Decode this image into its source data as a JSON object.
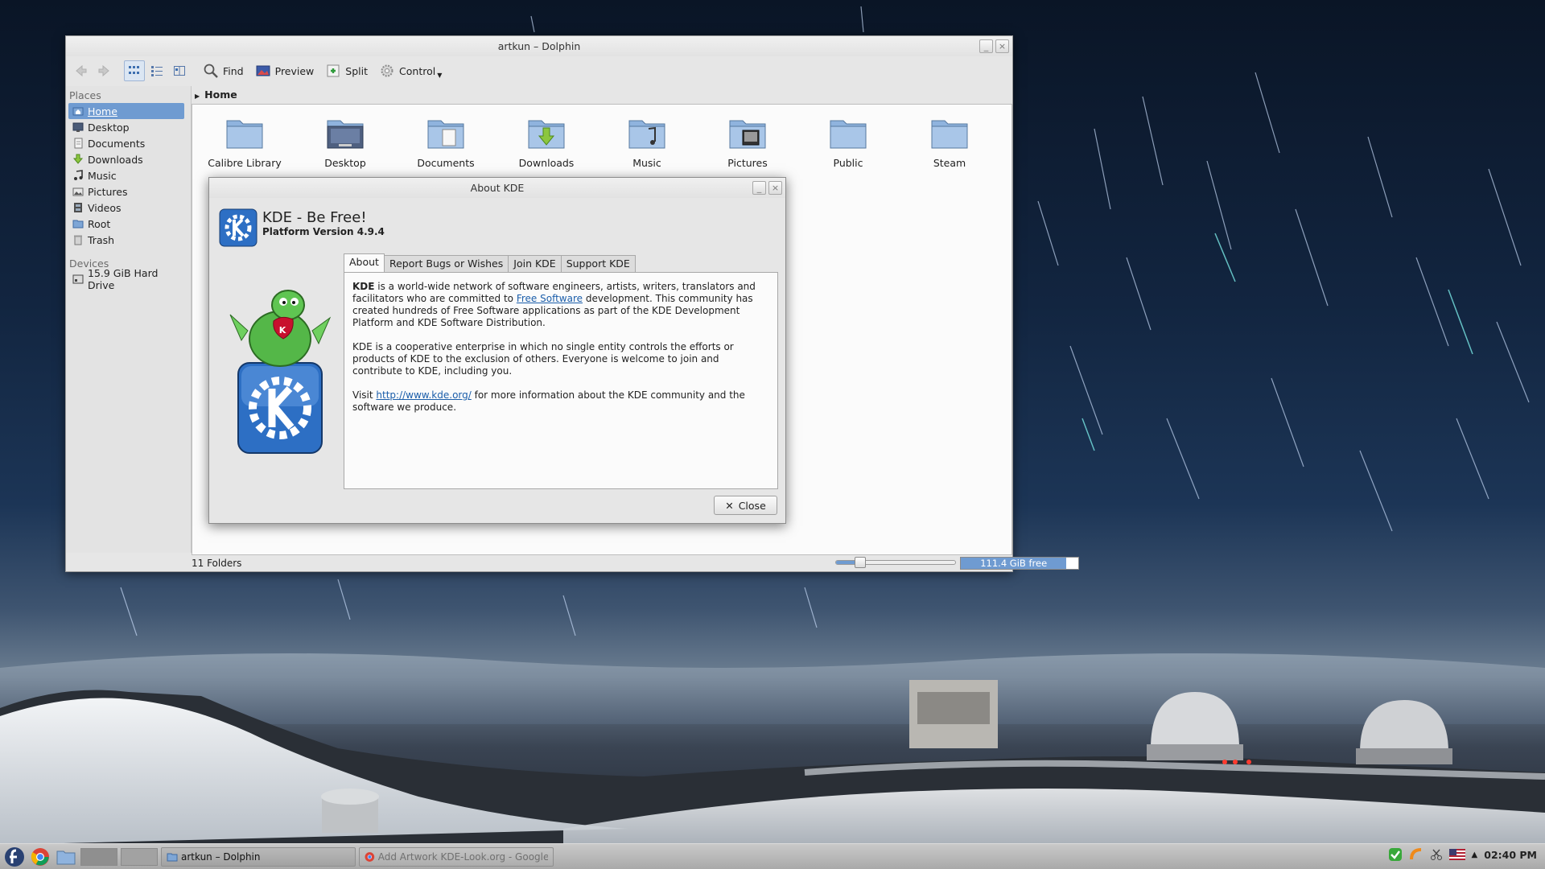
{
  "window": {
    "title": "artkun – Dolphin",
    "minimize_glyph": "_",
    "close_glyph": "×"
  },
  "toolbar": {
    "back_icon": "back-arrow-icon",
    "forward_icon": "forward-arrow-icon",
    "find_label": "Find",
    "preview_label": "Preview",
    "split_label": "Split",
    "control_label": "Control"
  },
  "places": {
    "places_heading": "Places",
    "devices_heading": "Devices",
    "items": [
      {
        "label": "Home",
        "icon": "home-folder-icon",
        "selected": true
      },
      {
        "label": "Desktop",
        "icon": "desktop-icon"
      },
      {
        "label": "Documents",
        "icon": "documents-icon"
      },
      {
        "label": "Downloads",
        "icon": "downloads-icon"
      },
      {
        "label": "Music",
        "icon": "music-icon"
      },
      {
        "label": "Pictures",
        "icon": "pictures-icon"
      },
      {
        "label": "Videos",
        "icon": "videos-icon"
      },
      {
        "label": "Root",
        "icon": "root-folder-icon"
      },
      {
        "label": "Trash",
        "icon": "trash-icon"
      }
    ],
    "devices": [
      {
        "label": "15.9 GiB Hard Drive",
        "icon": "hard-drive-icon"
      }
    ]
  },
  "breadcrumb": {
    "arrow": "▶",
    "current": "Home"
  },
  "files": [
    {
      "name": "Calibre Library",
      "icon": "folder-icon"
    },
    {
      "name": "Desktop",
      "icon": "folder-desktop-icon"
    },
    {
      "name": "Documents",
      "icon": "folder-documents-icon"
    },
    {
      "name": "Downloads",
      "icon": "folder-downloads-icon"
    },
    {
      "name": "Music",
      "icon": "folder-music-icon"
    },
    {
      "name": "Pictures",
      "icon": "folder-pictures-icon"
    },
    {
      "name": "Public",
      "icon": "folder-icon"
    },
    {
      "name": "Steam",
      "icon": "folder-icon"
    }
  ],
  "status": {
    "count": "11 Folders",
    "free": "111.4 GiB free",
    "zoom_level": 0.2,
    "used_fraction": 0.9
  },
  "about": {
    "title": "About KDE",
    "heading": "KDE - Be Free!",
    "subheading": "Platform Version 4.9.4",
    "tabs": [
      "About",
      "Report Bugs or Wishes",
      "Join KDE",
      "Support KDE"
    ],
    "p1_bold": "KDE",
    "p1_a": " is a world-wide network of software engineers, artists, writers, translators and facilitators who are committed to ",
    "p1_link": "Free Software",
    "p1_b": " development. This community has created hundreds of Free Software applications as part of the KDE Development Platform and KDE Software Distribution.",
    "p2": "KDE is a cooperative enterprise in which no single entity controls the efforts or products of KDE to the exclusion of others. Everyone is welcome to join and contribute to KDE, including you.",
    "p3_a": "Visit ",
    "p3_link": "http://www.kde.org/",
    "p3_b": " for more information about the KDE community and the software we produce.",
    "close_label": "Close",
    "close_glyph": "✕"
  },
  "taskbar": {
    "tasks": [
      {
        "label": "artkun – Dolphin",
        "active": true
      },
      {
        "label": "Add Artwork KDE-Look.org - Google Ch",
        "active": false
      }
    ],
    "clock": "02:40 PM"
  },
  "colors": {
    "selection": "#6f9bd1",
    "link": "#1b5eaa",
    "window_bg": "#e6e6e6"
  }
}
